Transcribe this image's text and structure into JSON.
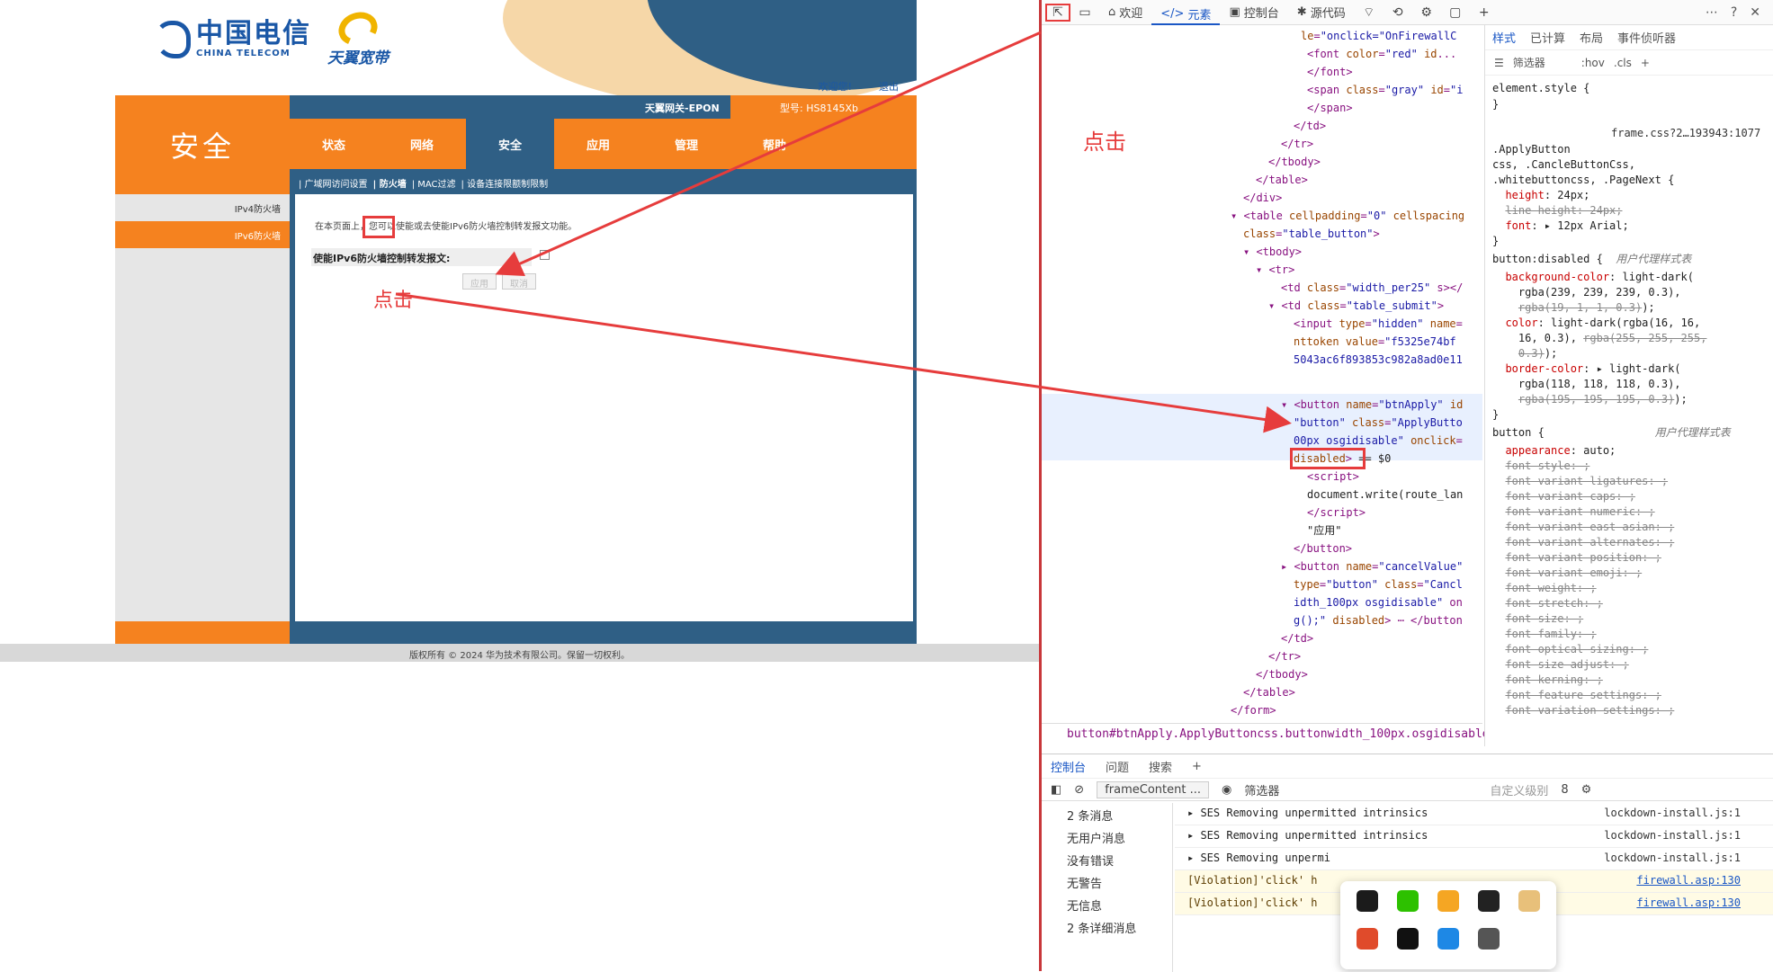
{
  "router": {
    "logo_cn": "中国电信",
    "logo_en": "CHINA TELECOM",
    "tianyi": "天翼宽带",
    "toplinks": [
      "欢迎您!",
      "退出"
    ],
    "section_title": "安全",
    "gateway": "天翼网关-EPON",
    "model": "型号: HS8145Xb",
    "nav": [
      "状态",
      "网络",
      "安全",
      "应用",
      "管理",
      "帮助"
    ],
    "nav_active": 2,
    "subnav": [
      "| 广域网访问设置",
      "| 防火墙",
      "| MAC过滤",
      "| 设备连接限额制限制"
    ],
    "sidebar": [
      "IPv4防火墙",
      "IPv6防火墙"
    ],
    "desc": "在本页面上，您可以使能或去使能IPv6防火墙控制转发报文功能。",
    "label": "使能IPv6防火墙控制转发报文:",
    "apply": "应用",
    "cancel": "取消",
    "copyright": "版权所有 © 2024 华为技术有限公司。保留一切权利。"
  },
  "notes": {
    "click1": "点击",
    "click2": "点击"
  },
  "devtools": {
    "tabs": [
      "欢迎",
      "元素",
      "控制台",
      "源代码"
    ],
    "active_tab": "元素",
    "style_tabs": [
      "样式",
      "已计算",
      "布局",
      "事件侦听器"
    ],
    "filter": "筛选器",
    "hov": ":hov",
    "cls": ".cls",
    "breadcrumb": "button#btnApply.ApplyButtoncss.buttonwidth_100px.osgidisable",
    "console_tabs": [
      "控制台",
      "问题",
      "搜索"
    ],
    "context": "frameContent ...",
    "level": "自定义级别",
    "count": "8",
    "sidebar": [
      "2 条消息",
      "无用户消息",
      "没有错误",
      "无警告",
      "无信息",
      "2 条详细消息"
    ],
    "messages": [
      {
        "text": "SES Removing unpermitted intrinsics",
        "src": "lockdown-install.js:1"
      },
      {
        "text": "SES Removing unpermitted intrinsics",
        "src": "lockdown-install.js:1"
      },
      {
        "text": "SES Removing unpermi",
        "src": "lockdown-install.js:1"
      },
      {
        "text": "[Violation]'click' h",
        "src": "firewall.asp:130"
      },
      {
        "text": "[Violation]'click' h",
        "src": "firewall.asp:130"
      }
    ]
  },
  "colors": {
    "orange": "#f5821f",
    "blue": "#2f5f85",
    "red": "#e63c3c",
    "accent": "#1a57c5"
  }
}
